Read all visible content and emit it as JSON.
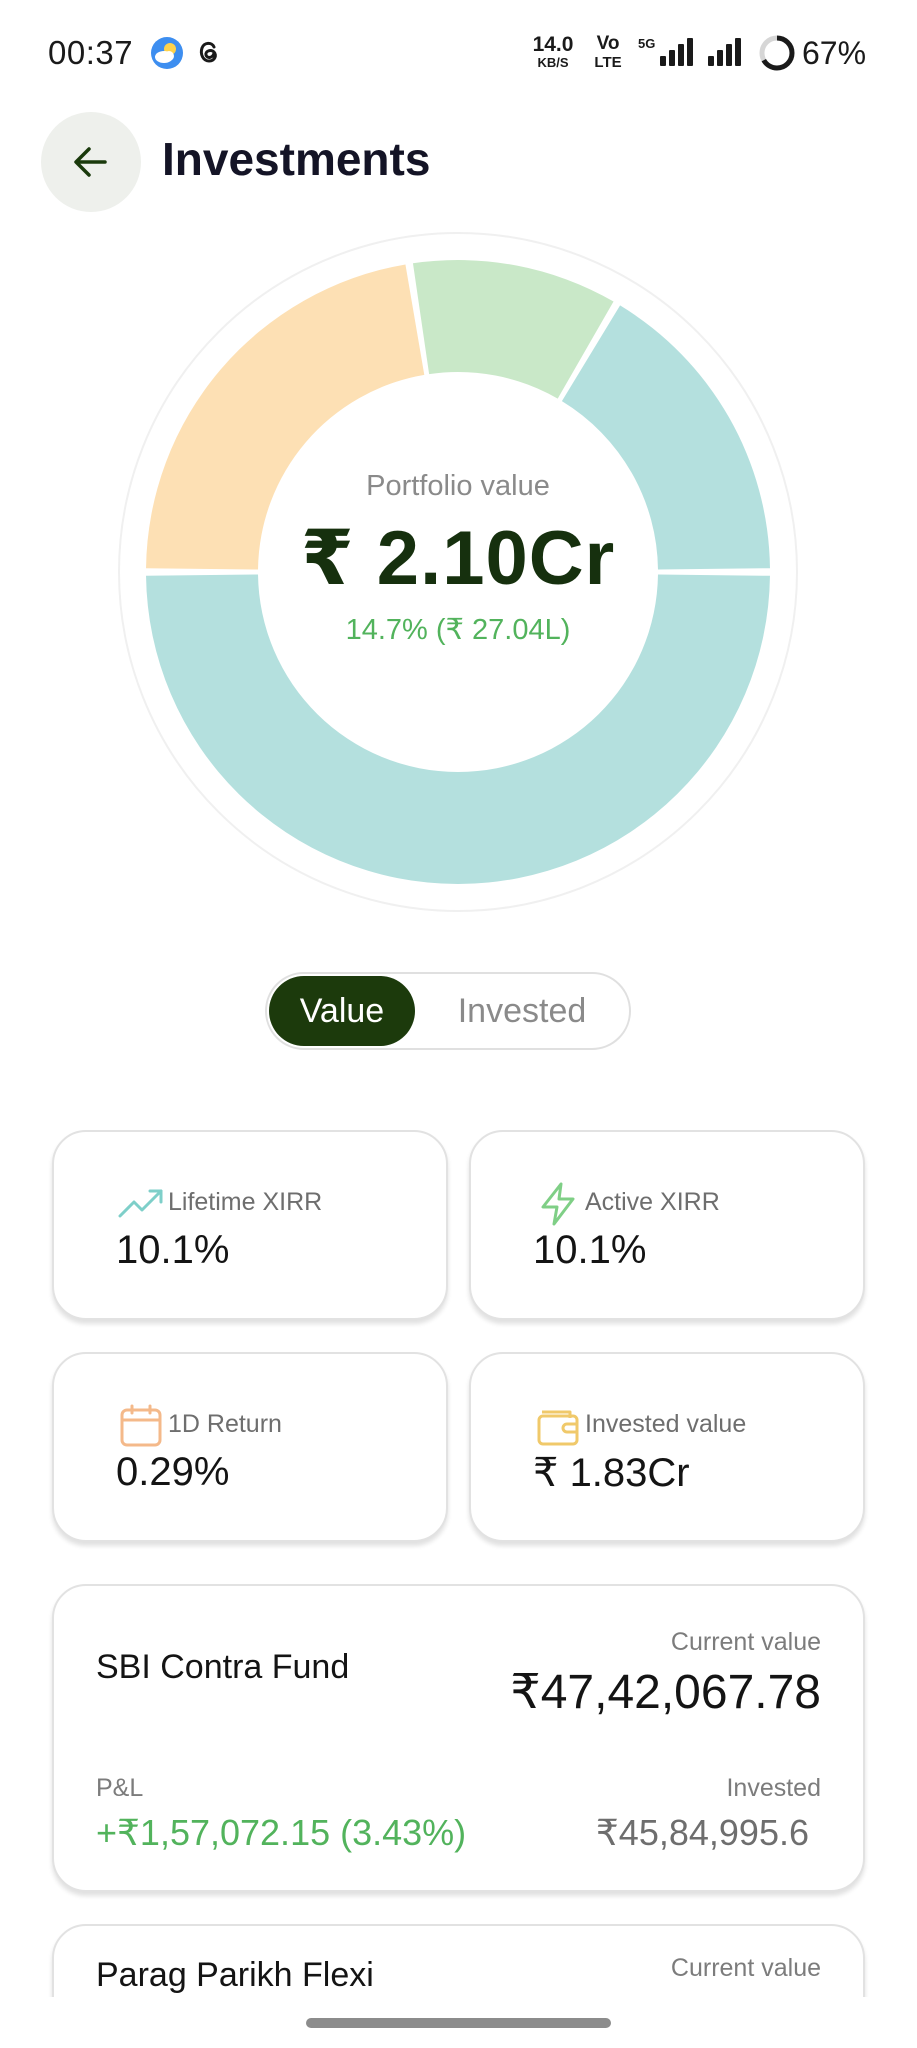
{
  "status_bar": {
    "time": "00:37",
    "net_speed_value": "14.0",
    "net_speed_unit": "KB/S",
    "volte_top": "Vo",
    "volte_bottom": "LTE",
    "network_type": "5G",
    "battery_percent": "67%",
    "battery_level": 0.67,
    "icons": [
      "weather-cloud-sun-icon",
      "threads-icon",
      "signal-icon",
      "signal-icon",
      "battery-ring-icon"
    ]
  },
  "header": {
    "title": "Investments",
    "back_icon": "arrow-left-icon"
  },
  "portfolio": {
    "label": "Portfolio value",
    "value": "₹ 2.10Cr",
    "return_text": "14.7% (₹ 27.04L)",
    "return_color": "#52b35c"
  },
  "chart_data": {
    "type": "pie",
    "style": "donut",
    "slices": [
      {
        "value": 0.5,
        "color": "#b4e0de"
      },
      {
        "value": 0.225,
        "color": "#fde0b4"
      },
      {
        "value": 0.11,
        "color": "#c9e8c8"
      },
      {
        "value": 0.165,
        "color": "#b4e0de"
      }
    ],
    "center_label": "Portfolio value",
    "center_value": "₹ 2.10Cr"
  },
  "toggle": {
    "options": [
      "Value",
      "Invested"
    ],
    "selected": "Value",
    "active_color": "#1c3a0c"
  },
  "stats": [
    {
      "label": "Lifetime XIRR",
      "value": "10.1%",
      "icon": "trending-up-icon",
      "icon_color": "#7ecfc9"
    },
    {
      "label": "Active XIRR",
      "value": "10.1%",
      "icon": "lightning-icon",
      "icon_color": "#7fcf86"
    },
    {
      "label": "1D Return",
      "value": "0.29%",
      "icon": "calendar-icon",
      "icon_color": "#f4b98a"
    },
    {
      "label": "Invested value",
      "value": "₹ 1.83Cr",
      "icon": "wallet-icon",
      "icon_color": "#f0c96a"
    }
  ],
  "funds": [
    {
      "name": "SBI Contra Fund",
      "current_label": "Current value",
      "current_value": "₹47,42,067.78",
      "pl_label": "P&L",
      "pl_value": "+₹1,57,072.15 (3.43%)",
      "invested_label": "Invested",
      "invested_value": "₹45,84,995.6"
    },
    {
      "name": "Parag Parikh Flexi",
      "current_label": "Current value"
    }
  ]
}
